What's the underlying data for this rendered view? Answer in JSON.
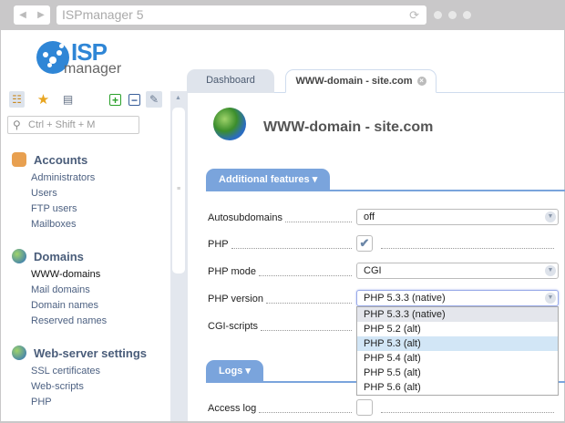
{
  "browser": {
    "url": "ISPmanager 5",
    "back": "◀",
    "forward": "▶",
    "reload": "⟳"
  },
  "logo": {
    "isp": "ISP",
    "manager": "manager"
  },
  "search": {
    "placeholder": "Ctrl + Shift + M"
  },
  "sidebar": {
    "groups": [
      {
        "title": "Accounts",
        "items": [
          "Administrators",
          "Users",
          "FTP users",
          "Mailboxes"
        ]
      },
      {
        "title": "Domains",
        "items": [
          "WWW-domains",
          "Mail domains",
          "Domain names",
          "Reserved names"
        ]
      },
      {
        "title": "Web-server settings",
        "items": [
          "SSL certificates",
          "Web-scripts",
          "PHP"
        ]
      }
    ]
  },
  "tabs": [
    {
      "label": "Dashboard"
    },
    {
      "label": "WWW-domain - site.com",
      "close": "×"
    }
  ],
  "form": {
    "title": "WWW-domain - site.com",
    "sections": {
      "additional": "Additional features",
      "logs": "Logs"
    },
    "fields": {
      "autosub": {
        "label": "Autosubdomains",
        "value": "off"
      },
      "php": {
        "label": "PHP",
        "checked": true,
        "mark": "✔"
      },
      "php_mode": {
        "label": "PHP mode",
        "value": "CGI"
      },
      "php_version": {
        "label": "PHP version",
        "value": "PHP 5.3.3 (native)"
      },
      "cgi": {
        "label": "CGI-scripts"
      },
      "access_log": {
        "label": "Access log",
        "checked": false
      }
    },
    "php_version_options": [
      "PHP 5.3.3 (native)",
      "PHP 5.2 (alt)",
      "PHP 5.3 (alt)",
      "PHP 5.4 (alt)",
      "PHP 5.5 (alt)",
      "PHP 5.6 (alt)"
    ]
  },
  "colors": {
    "accent": "#7aa4dc",
    "brand": "#2f86d6"
  }
}
